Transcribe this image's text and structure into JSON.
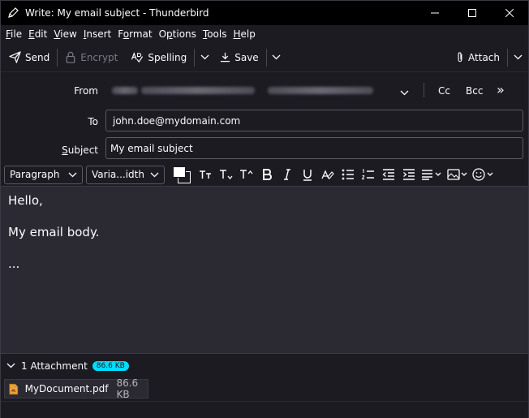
{
  "window": {
    "title": "Write: My email subject - Thunderbird"
  },
  "menu": [
    {
      "key": "F",
      "rest": "ile"
    },
    {
      "key": "E",
      "rest": "dit"
    },
    {
      "key": "V",
      "rest": "iew"
    },
    {
      "key": "I",
      "rest": "nsert"
    },
    {
      "key": "",
      "pre": "F",
      "key2": "o",
      "rest": "rmat"
    },
    {
      "key": "",
      "pre": "O",
      "key2": "p",
      "rest": "tions"
    },
    {
      "key": "T",
      "rest": "ools"
    },
    {
      "key": "H",
      "rest": "elp"
    }
  ],
  "menu_labels": {
    "file": "File",
    "edit": "Edit",
    "view": "View",
    "insert": "Insert",
    "format": "Format",
    "options": "Options",
    "tools": "Tools",
    "help": "Help"
  },
  "toolbar": {
    "send": "Send",
    "encrypt": "Encrypt",
    "spelling": "Spelling",
    "save": "Save",
    "attach": "Attach"
  },
  "headers": {
    "from_label": "From",
    "to_label": "To",
    "subject_label": "Subject",
    "to_value": "john.doe@mydomain.com",
    "subject_value": "My email subject",
    "cc": "Cc",
    "bcc": "Bcc",
    "more": "»"
  },
  "format": {
    "paragraph": "Paragraph",
    "font": "Varia...idth"
  },
  "body": {
    "lines": [
      "Hello,",
      "My email body.",
      "..."
    ]
  },
  "attachments": {
    "count_label": "1 Attachment",
    "total_size": "86.6 KB",
    "items": [
      {
        "name": "MyDocument.pdf",
        "size": "86.6 KB"
      }
    ]
  },
  "colors": {
    "accent": "#00ddff",
    "background": "#1c1b22",
    "editor": "#2b2a33"
  }
}
